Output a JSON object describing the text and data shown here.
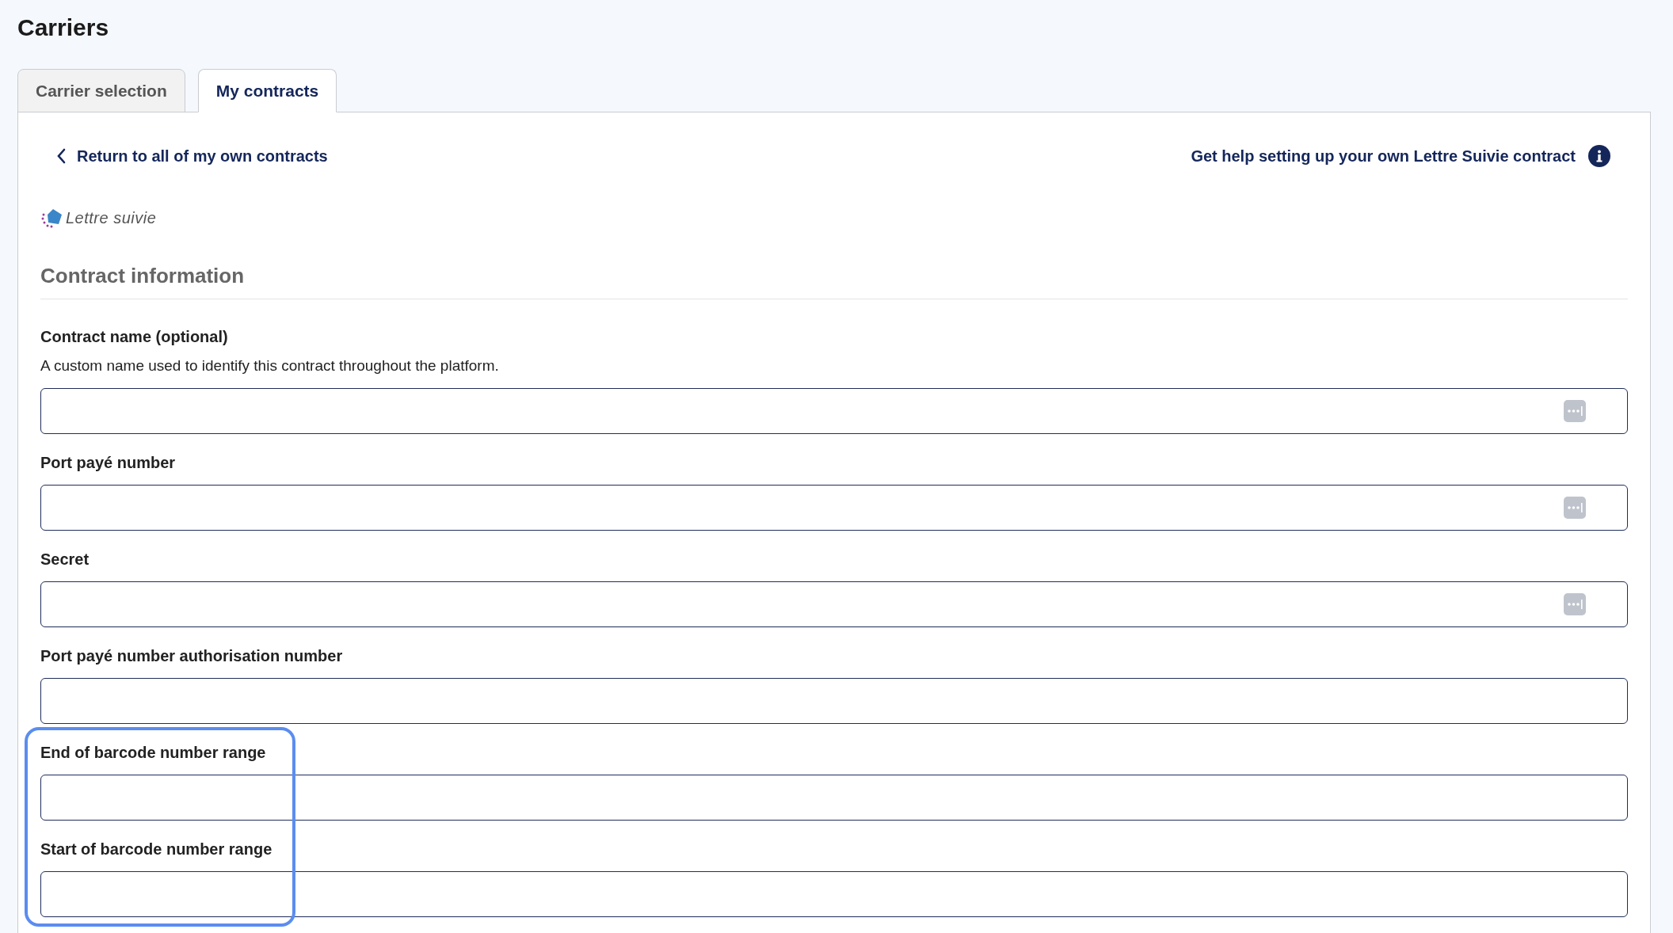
{
  "page_title": "Carriers",
  "tabs": [
    {
      "label": "Carrier selection",
      "selected": false
    },
    {
      "label": "My contracts",
      "selected": true
    }
  ],
  "back_link": "Return to all of my own contracts",
  "help_link": "Get help setting up your own Lettre Suivie contract",
  "logo_text": "Lettre suivie",
  "section_title": "Contract information",
  "fields": [
    {
      "label": "Contract name (optional)",
      "description": "A custom name used to identify this contract throughout the platform.",
      "autofill_icon": true,
      "highlighted": false
    },
    {
      "label": "Port payé number",
      "autofill_icon": true,
      "highlighted": false
    },
    {
      "label": "Secret",
      "autofill_icon": true,
      "highlighted": false
    },
    {
      "label": "Port payé number authorisation number",
      "autofill_icon": false,
      "highlighted": false
    },
    {
      "label": "End of barcode number range",
      "autofill_icon": false,
      "highlighted": true
    },
    {
      "label": "Start of barcode number range",
      "autofill_icon": false,
      "highlighted": true
    }
  ]
}
